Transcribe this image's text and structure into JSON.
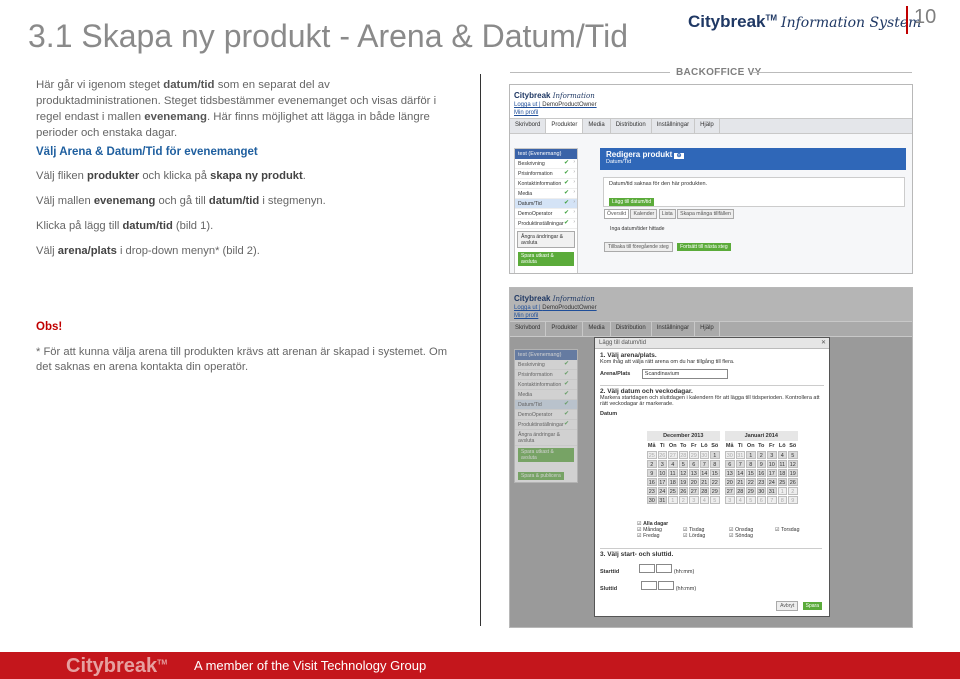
{
  "header": {
    "title": "3.1 Skapa ny produkt - Arena & Datum/Tid",
    "brand_name": "Citybreak",
    "brand_tm": "TM",
    "brand_sub": "Information System",
    "page_number": "10"
  },
  "intro": {
    "p1_pre": "Här går vi igenom steget ",
    "p1_bold1": "datum/tid",
    "p1_mid": " som en separat del av produktadministrationen. Steget tidsbestämmer evenemanget och visas därför i regel endast i mallen ",
    "p1_bold2": "evenemang",
    "p1_post": ". Här finns möjlighet att lägga in både längre perioder och enstaka dagar."
  },
  "section_heading": "Välj Arena & Datum/Tid för evenemanget",
  "steps": [
    {
      "pre": "Välj fliken ",
      "b1": "produkter",
      "mid": " och klicka på ",
      "b2": "skapa ny produkt",
      "post": "."
    },
    {
      "pre": "Välj mallen ",
      "b1": "evenemang",
      "mid": " och gå till ",
      "b2": "datum/tid",
      "post": " i stegmenyn."
    },
    {
      "pre": "Klicka på lägg till ",
      "b1": "datum/tid",
      "mid": " (bild 1).",
      "b2": "",
      "post": ""
    },
    {
      "pre": "Välj ",
      "b1": "arena/plats",
      "mid": " i drop-down menyn* (bild 2).",
      "b2": "",
      "post": ""
    }
  ],
  "obs": "Obs!",
  "note": "* För att kunna välja arena till produkten krävs att arenan är skapad i systemet. Om det saknas en arena kontakta din operatör.",
  "backoffice_label": "BACKOFFICE VY",
  "shot1": {
    "logo": "Citybreak",
    "logo_sub": "Information",
    "logout": "Logga ut",
    "user": "DemoProductOwner",
    "profile": "Min profil",
    "nav": [
      "Skrivbord",
      "Produkter",
      "Media",
      "Distribution",
      "Inställningar",
      "Hjälp"
    ],
    "side_header": "test (Evenemang)",
    "side_items": [
      "Beskrivning",
      "Prisinformation",
      "Kontaktinformation",
      "Media",
      "Datum/Tid",
      "DemoOperator",
      "Produktinställningar"
    ],
    "side_links": [
      "Ångra ändringar & avsluta",
      "Spara utkast & avsluta",
      "Spara & publicera"
    ],
    "panel_title": "Redigera produkt",
    "panel_sub": "Datum/Tid",
    "msg": "Datum/tid saknas för den här produkten.",
    "add_btn": "Lägg till datum/tid",
    "tabs": [
      "Översikt",
      "Kalender",
      "Lista",
      "Skapa många tillfällen"
    ],
    "none": "Inga datum/tider hittade",
    "back_btn": "Tillbaka till föregående steg",
    "next_btn": "Fortsätt till nästa steg"
  },
  "shot2": {
    "dlg_title": "Lägg till datum/tid",
    "s1_title": "1. Välj arena/plats.",
    "s1_text": "Kom ihåg att välja rätt arena om du har tillgång till flera.",
    "arena_label": "Arena/Plats",
    "arena_value": "Scandinavium",
    "s2_title": "2. Välj datum och veckodagar.",
    "s2_text": "Markera startdagen och sluttdagen i kalendern för att lägga till tidsperioden. Kontrollera att rätt veckodagar är markerade.",
    "date_label": "Datum",
    "month1": "December 2013",
    "month2": "Januari 2014",
    "weekdays": [
      "Må",
      "Ti",
      "On",
      "To",
      "Fr",
      "Lö",
      "Sö"
    ],
    "dec": [
      "25",
      "26",
      "27",
      "28",
      "29",
      "30",
      "1",
      "2",
      "3",
      "4",
      "5",
      "6",
      "7",
      "8",
      "9",
      "10",
      "11",
      "12",
      "13",
      "14",
      "15",
      "16",
      "17",
      "18",
      "19",
      "20",
      "21",
      "22",
      "23",
      "24",
      "25",
      "26",
      "27",
      "28",
      "29",
      "30",
      "31",
      "1",
      "2",
      "3",
      "4",
      "5"
    ],
    "jan": [
      "30",
      "31",
      "1",
      "2",
      "3",
      "4",
      "5",
      "6",
      "7",
      "8",
      "9",
      "10",
      "11",
      "12",
      "13",
      "14",
      "15",
      "16",
      "17",
      "18",
      "19",
      "20",
      "21",
      "22",
      "23",
      "24",
      "25",
      "26",
      "27",
      "28",
      "29",
      "30",
      "31",
      "1",
      "2",
      "3",
      "4",
      "5",
      "6",
      "7",
      "8",
      "9"
    ],
    "all_days": "Alla dagar",
    "days": [
      "Måndag",
      "Tisdag",
      "Onsdag",
      "Torsdag",
      "Fredag",
      "Lördag",
      "Söndag"
    ],
    "s3_title": "3. Välj start- och sluttid.",
    "start_label": "Starttid",
    "end_label": "Sluttid",
    "hhmm": "(hh:mm)",
    "cancel": "Avbryt",
    "save": "Spara"
  },
  "footer": {
    "brand": "Citybreak",
    "tm": "TM",
    "tagline": "A member of the Visit Technology Group"
  }
}
